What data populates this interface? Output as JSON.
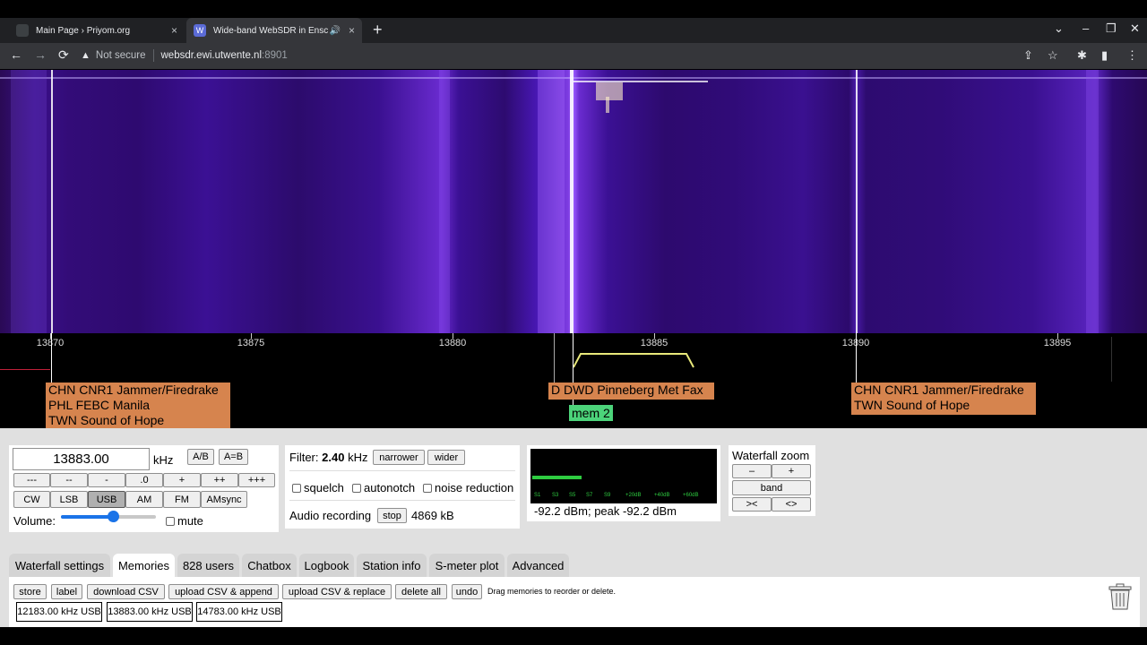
{
  "browser": {
    "tabs": [
      {
        "title": "Main Page › Priyom.org",
        "close": "×"
      },
      {
        "title": "Wide-band WebSDR in Ensc",
        "close": "×",
        "audio": "🔊"
      }
    ],
    "new_tab": "+",
    "address": {
      "security": "Not secure",
      "host": "websdr.ewi.utwente.nl",
      "port": ":8901"
    },
    "window_controls": {
      "dropdown": "⌄",
      "minimize": "–",
      "restore": "❐",
      "close": "✕"
    },
    "nav": {
      "back": "←",
      "forward": "→",
      "reload": "⟳"
    },
    "toolbar_icons": {
      "share": "⇪",
      "star": "☆",
      "extensions": "✱",
      "sidepanel": "▮",
      "menu": "⋮"
    }
  },
  "scale": {
    "ticks": [
      "13870",
      "13875",
      "13880",
      "13885",
      "13890",
      "13895"
    ]
  },
  "stations": [
    {
      "lines": "CHN CNR1 Jammer/Firedrake\nPHL FEBC Manila\nTWN Sound of Hope"
    },
    {
      "lines": "D DWD Pinneberg Met Fax"
    },
    {
      "lines": "CHN CNR1 Jammer/Firedrake\nTWN Sound of Hope"
    }
  ],
  "memory_marker": "mem 2",
  "frequency": {
    "value": "13883.00",
    "unit": "kHz",
    "ab": "A/B",
    "aeqb": "A=B",
    "step_buttons": [
      "---",
      "--",
      "-",
      ".0",
      "+",
      "++",
      "+++"
    ],
    "modes": [
      "CW",
      "LSB",
      "USB",
      "AM",
      "FM",
      "AMsync"
    ],
    "selected_mode": "USB",
    "volume_label": "Volume:",
    "volume_level": 0.55,
    "mute_label": "mute"
  },
  "filter": {
    "label": "Filter:",
    "value": "2.40",
    "unit": "kHz",
    "narrower": "narrower",
    "wider": "wider",
    "squelch": "squelch",
    "autonotch": "autonotch",
    "noise_reduction": "noise reduction",
    "recording_label": "Audio recording",
    "stop": "stop",
    "recording_size": "4869 kB"
  },
  "smeter": {
    "scale": [
      "S1",
      "S3",
      "S5",
      "S7",
      "S9",
      "+20dB",
      "+40dB",
      "+60dB"
    ],
    "level_fraction": 0.27,
    "readout": "-92.2 dBm; peak  -92.2 dBm",
    "bar_color": "#2ecc40"
  },
  "waterfall_zoom": {
    "title": "Waterfall zoom",
    "minus": "–",
    "plus": "+",
    "band": "band",
    "left": "><",
    "right": "<>"
  },
  "panel_tabs": [
    "Waterfall settings",
    "Memories",
    "828 users",
    "Chatbox",
    "Logbook",
    "Station info",
    "S-meter plot",
    "Advanced"
  ],
  "active_tab": "Memories",
  "memories": {
    "buttons": [
      "store",
      "label",
      "download CSV",
      "upload CSV & append",
      "upload CSV & replace",
      "delete all",
      "undo"
    ],
    "hint": "Drag memories to reorder or delete.",
    "entries": [
      "12183.00 kHz USB",
      "13883.00 kHz USB",
      "14783.00 kHz USB"
    ]
  },
  "colors": {
    "station_label": "#d6844e",
    "memory_marker": "#4cd37a",
    "passband": "#e8e87a"
  }
}
